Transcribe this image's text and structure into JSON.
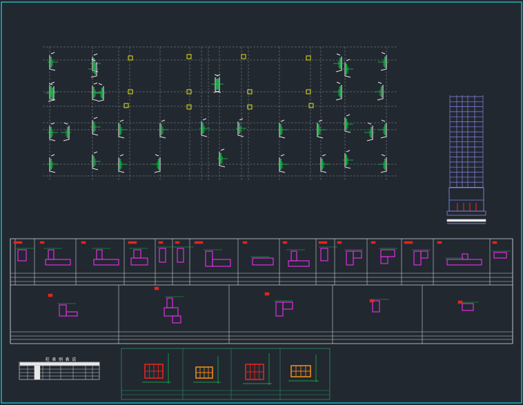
{
  "canvas": {
    "background": "#212830",
    "frame_color": "#27d3e0",
    "white_line": "#e8e8e8",
    "grid_line_color": "#8a8f96"
  },
  "colors": {
    "column_green": "#19c34a",
    "axis_yellow": "#e6e21a",
    "section_magenta": "#e030e0",
    "section_red": "#e8241c",
    "section_orange": "#f08a1c",
    "elevation_blue": "#8a86e8",
    "table_line": "#cfd3d8",
    "marker_red": "#e8241c"
  },
  "plan": {
    "description_shown": false,
    "column_groups": 36
  },
  "elevation": {
    "floors": 18
  },
  "detail_table": {
    "row1_cells": 16,
    "row2_cells": 5
  },
  "legend_table": {
    "title": "柱 表 例 表 说"
  },
  "section_details": {
    "count": 4
  },
  "icons": {
    "column_mark": "square-icon",
    "section_marker": "flag-icon"
  }
}
